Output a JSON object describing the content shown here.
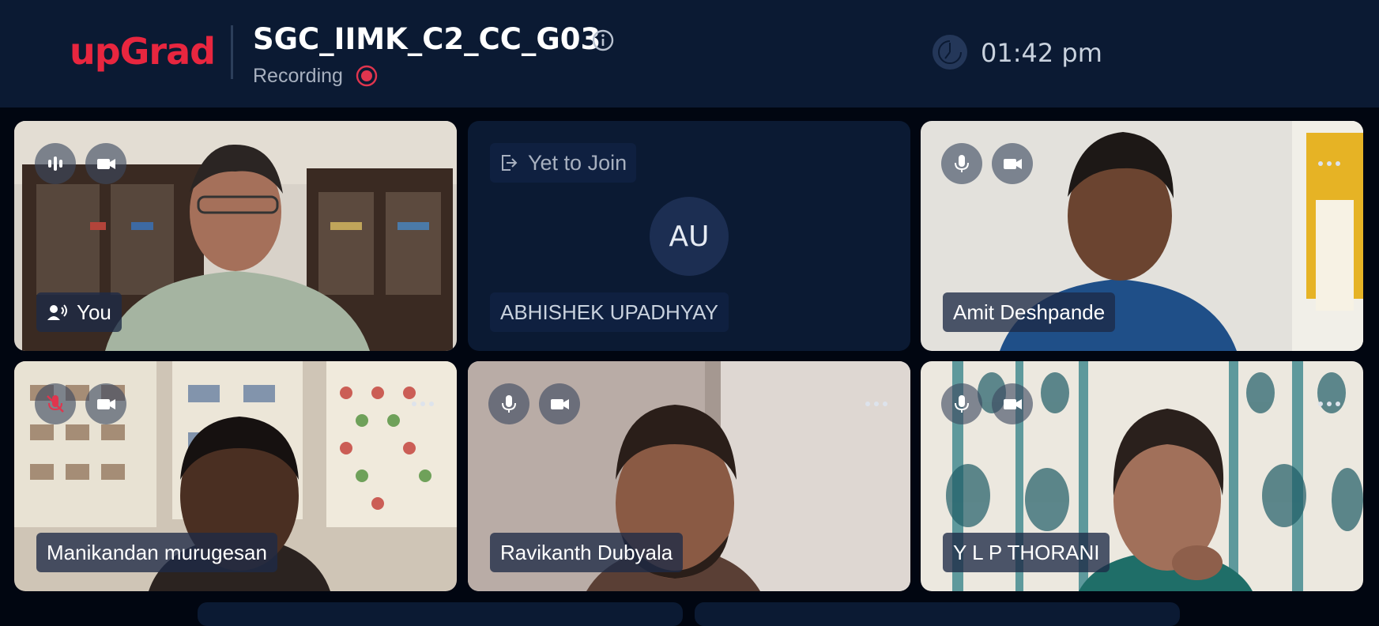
{
  "header": {
    "logo_text": "upGrad",
    "meeting_title": "SGC_IIMK_C2_CC_G03",
    "recording_label": "Recording",
    "clock": "01:42 pm",
    "colors": {
      "brand": "#e8263f",
      "recording": "#e0354e",
      "background": "#0b1a33"
    }
  },
  "participants": [
    {
      "name": "You",
      "status": "video",
      "speaking": true,
      "mic": "active"
    },
    {
      "name": "ABHISHEK UPADHYAY",
      "status": "yet-to-join",
      "initials": "AU",
      "badge": "Yet to Join"
    },
    {
      "name": "Amit Deshpande",
      "status": "video",
      "mic": "on"
    },
    {
      "name": "Manikandan murugesan",
      "status": "video",
      "mic": "muted"
    },
    {
      "name": "Ravikanth Dubyala",
      "status": "video",
      "mic": "on"
    },
    {
      "name": "Y L P THORANI",
      "status": "video",
      "mic": "on"
    }
  ],
  "icons": {
    "info": "info-icon",
    "recording": "record-icon",
    "clock": "clock-icon",
    "mic": "mic-icon",
    "mic_muted": "mic-muted-icon",
    "camera": "camera-icon",
    "more": "more-options-icon",
    "leave": "join-arrow-icon",
    "speaker": "speaking-person-icon"
  }
}
